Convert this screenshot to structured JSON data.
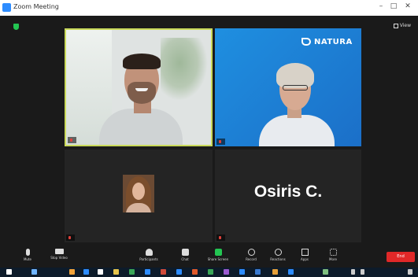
{
  "window": {
    "title": "Zoom Meeting"
  },
  "header": {
    "view_label": "View"
  },
  "tiles": [
    {
      "name": "Participant",
      "caption": ""
    },
    {
      "name": "Participant",
      "caption": "",
      "logo_text": "NATURA"
    },
    {
      "name": "Participant",
      "caption": ""
    },
    {
      "name": "Osiris C.",
      "caption": ""
    }
  ],
  "controls": {
    "mute": "Mute",
    "stop_video": "Stop Video",
    "participants": "Participants",
    "chat": "Chat",
    "share": "Share Screen",
    "record": "Record",
    "reactions": "Reactions",
    "apps": "Apps",
    "more": "More",
    "end": "End"
  },
  "taskbar": {
    "time": "",
    "date": ""
  },
  "colors": {
    "active_speaker_border": "#c9d95a",
    "share_green": "#23c552",
    "end_red": "#e02828",
    "tile_blue": "#1f8fe0"
  }
}
